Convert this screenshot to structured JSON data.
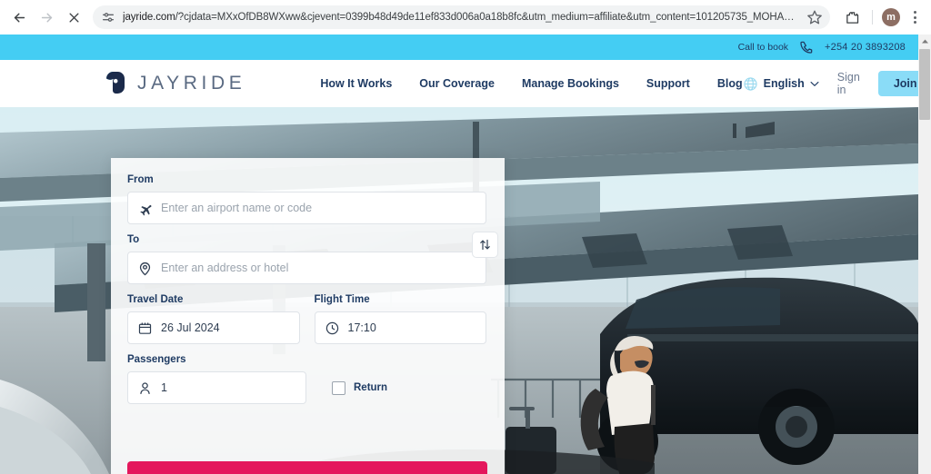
{
  "browser": {
    "url_domain": "jayride.com",
    "url_path": "/?cjdata=MXxOfDB8WXww&cjevent=0399b48d49de11ef833d006a0a18b8fc&utm_medium=affiliate&utm_content=101205735_MOHAMED+ADOW+ABS…",
    "back_label": "Back",
    "forward_label": "Forward",
    "stop_label": "Stop",
    "site_info_label": "View site information",
    "bookmark_label": "Bookmark this tab",
    "extensions_label": "Extensions",
    "profile_initial": "m",
    "menu_label": "Customize and control Google Chrome"
  },
  "topbar": {
    "call_label": "Call to book",
    "phone": "+254 20 3893208",
    "bg_color": "#44cdf3"
  },
  "header": {
    "brand": "JAYRIDE",
    "nav": [
      {
        "label": "How It Works"
      },
      {
        "label": "Our Coverage"
      },
      {
        "label": "Manage Bookings"
      },
      {
        "label": "Support"
      },
      {
        "label": "Blog"
      }
    ],
    "language": "English",
    "sign_in": "Sign in",
    "join": "Join",
    "join_bg": "#8adcf7",
    "text_color": "#1f3b63"
  },
  "booking_form": {
    "from_label": "From",
    "from_placeholder": "Enter an airport name or code",
    "from_value": "",
    "to_label": "To",
    "to_placeholder": "Enter an address or hotel",
    "to_value": "",
    "swap_label": "Swap from and to",
    "travel_date_label": "Travel Date",
    "travel_date_value": "26 Jul 2024",
    "flight_time_label": "Flight Time",
    "flight_time_value": "17:10",
    "passengers_label": "Passengers",
    "passengers_value": "1",
    "return_label": "Return",
    "return_checked": false,
    "search_button_color": "#e4175c"
  }
}
